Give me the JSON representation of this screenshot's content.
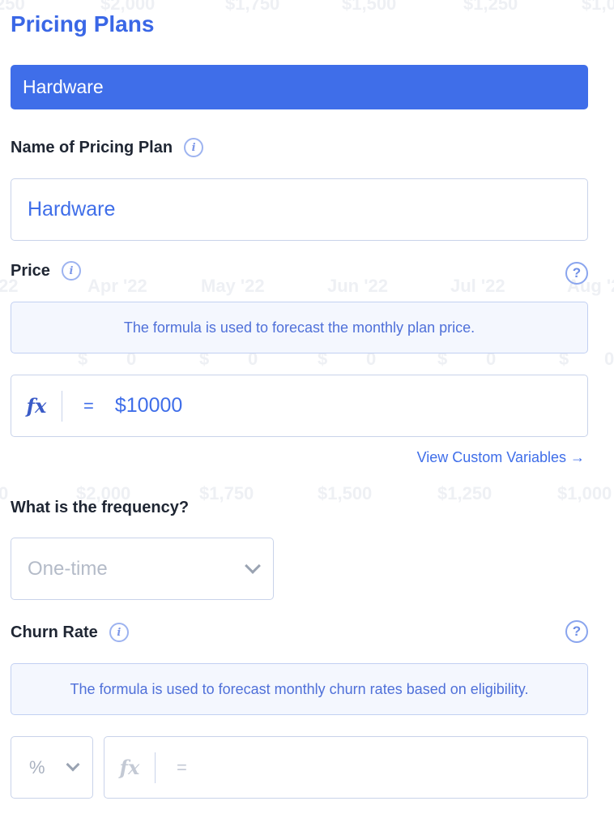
{
  "background": {
    "row1": [
      "250",
      "$2,000",
      "$1,750",
      "$1,500",
      "$1,250",
      "$1,0"
    ],
    "row2": [
      "22",
      "Apr '22",
      "May '22",
      "Jun '22",
      "Jul '22",
      "Aug '2"
    ],
    "row3": [
      "$",
      "0",
      "$",
      "0",
      "$",
      "0",
      "$",
      "0",
      "$",
      "0"
    ],
    "row4": [
      "0",
      "$2,000",
      "$1,750",
      "$1,500",
      "$1,250",
      "$1,000"
    ]
  },
  "page": {
    "title": "Pricing Plans"
  },
  "plan_bar": {
    "label": "Hardware"
  },
  "name_section": {
    "label": "Name of Pricing Plan",
    "value": "Hardware"
  },
  "price_section": {
    "label": "Price",
    "note": "The formula is used to forecast the monthly plan price.",
    "fx": "fx",
    "equals": "=",
    "value": "$10000",
    "link": "View Custom Variables →"
  },
  "frequency_section": {
    "label": "What is the frequency?",
    "placeholder": "One-time"
  },
  "churn_section": {
    "label": "Churn Rate",
    "note": "The formula is used to forecast monthly churn rates based on eligibility.",
    "unit": "%",
    "fx": "fx",
    "equals": "="
  },
  "icons": {
    "info": "i",
    "help": "?"
  },
  "colors": {
    "accent": "#3f6ee9",
    "title": "#3a67e6",
    "note_bg": "#f4f7fe",
    "border": "#c9d3ea"
  }
}
